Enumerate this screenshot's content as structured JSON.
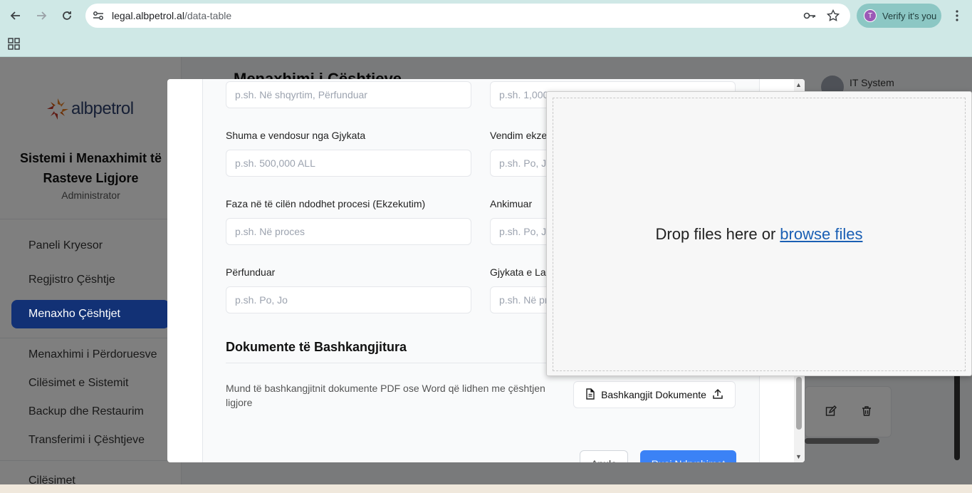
{
  "browser": {
    "url_host": "legal.albpetrol.al",
    "url_path": "/data-table",
    "verify_label": "Verify it's you",
    "profile_initial": "T"
  },
  "sidebar": {
    "logo_text": "albpetrol",
    "system_title_line1": "Sistemi i Menaxhimit të",
    "system_title_line2": "Rasteve Ligjore",
    "role": "Administrator",
    "items": [
      {
        "label": "Paneli Kryesor"
      },
      {
        "label": "Regjistro Çështje"
      },
      {
        "label": "Menaxho Çështjet"
      },
      {
        "label": "Menaxhimi i Përdoruesve"
      },
      {
        "label": "Cilësimet e Sistemit"
      },
      {
        "label": "Backup dhe Restaurim"
      },
      {
        "label": "Transferimi i Çështjeve"
      },
      {
        "label": "Cilësimet"
      }
    ]
  },
  "main": {
    "page_title": "Menaxhimi i Çështjeve",
    "user_name": "IT System"
  },
  "modal": {
    "fields": [
      {
        "label": "",
        "placeholder": "p.sh. Në shqyrtim, Përfunduar"
      },
      {
        "label": "",
        "placeholder": "p.sh. 1,000"
      },
      {
        "label": "Shuma e vendosur nga Gjykata",
        "placeholder": "p.sh. 500,000 ALL"
      },
      {
        "label": "Vendim ekze",
        "placeholder": "p.sh. Po, J"
      },
      {
        "label": "Faza në të cilën ndodhet procesi (Ekzekutim)",
        "placeholder": "p.sh. Në proces"
      },
      {
        "label": "Ankimuar",
        "placeholder": "p.sh. Po, J"
      },
      {
        "label": "Përfunduar",
        "placeholder": "p.sh. Po, Jo"
      },
      {
        "label": "Gjykata e La",
        "placeholder": "p.sh. Në pr"
      }
    ],
    "documents_title": "Dokumente të Bashkangjitura",
    "documents_desc": "Mund të bashkangjitnit dokumente PDF ose Word që lidhen me çështjen ligjore",
    "attach_label": "Bashkangjit Dokumente",
    "cancel_label": "Anulo",
    "save_label": "Ruaj Ndryshimet"
  },
  "dropzone": {
    "text": "Drop files here or",
    "link": "browse files"
  },
  "colors": {
    "accent": "#2563eb",
    "save": "#3b82f6",
    "chrome": "#cfe8e6"
  }
}
